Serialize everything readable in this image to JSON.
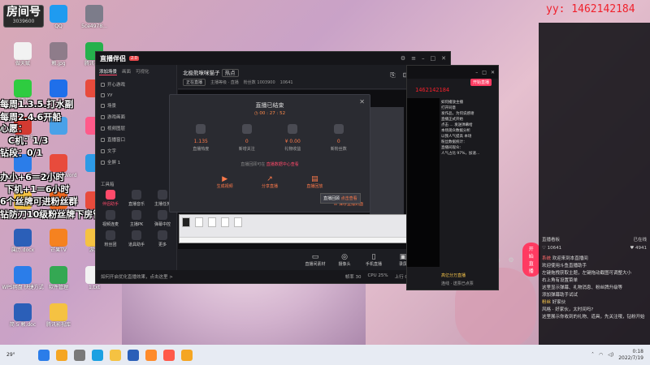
{
  "overlay": {
    "room_label": "房间号",
    "room_id": "3039600",
    "yy": "yy: 1462142184",
    "lines": [
      "每周1.3.5.打水副",
      "每周2.4.6开船",
      "心愿：",
      "C机：1/3",
      "钻段：0/1",
      "办小+6＝2小时",
      "下机+1＝6小时",
      "6个丝牌可进粉丝群",
      "钻防刀10级粉丝牌下房管"
    ]
  },
  "desktop_icons": [
    {
      "label": "",
      "color": "#e84b3c"
    },
    {
      "label": "QQ",
      "color": "#1f9bf0"
    },
    {
      "label": "5ce4978...",
      "color": "#7c7c8a"
    },
    {
      "label": "做天赋",
      "color": "#f2f2f2"
    },
    {
      "label": "赖.jpg",
      "color": "#8e7c8a"
    },
    {
      "label": "腾讯视频",
      "color": "#25b14c"
    },
    {
      "label": "爱奇艺",
      "color": "#2ecc40"
    },
    {
      "label": "",
      "color": "#1f6fea"
    },
    {
      "label": "",
      "color": "#e84b3c"
    },
    {
      "label": "网易云音乐",
      "color": "#d33a31"
    },
    {
      "label": "",
      "color": "#4aa1e8"
    },
    {
      "label": "",
      "color": "#ff5a8a"
    },
    {
      "label": "",
      "color": "#2b7de9"
    },
    {
      "label": "金山PDF转Word",
      "color": "#e84b3c"
    },
    {
      "label": "",
      "color": "#2d9ae6"
    },
    {
      "label": "搜狗高速浏览器",
      "color": "#f5c242"
    },
    {
      "label": "凡鱼直播伴侣",
      "color": "#f06a22"
    },
    {
      "label": "联想软件商店",
      "color": "#e84b3c"
    },
    {
      "label": "属历.docx",
      "color": "#2b5fb8"
    },
    {
      "label": "芒果TV",
      "color": "#f58220"
    },
    {
      "label": "游戏",
      "color": "#f5c242"
    },
    {
      "label": "WPS网盘 快捷方式",
      "color": "#2b7de9"
    },
    {
      "label": "软件管理",
      "color": "#34a853"
    },
    {
      "label": "1.txt",
      "color": "#f2f2f2"
    },
    {
      "label": "简 5 赖.doc",
      "color": "#2b5fb8"
    },
    {
      "label": "腾讯影视库",
      "color": "#f5c242"
    }
  ],
  "app": {
    "name": "直播伴侣",
    "version_badge": "2.0",
    "left_tabs": [
      "添加场景",
      "画面",
      "可视化"
    ],
    "scenes": [
      "开心游戏",
      "yy",
      "场景",
      "游戏画面",
      "视频图层",
      "直播窗口",
      "文字",
      "全屏 1"
    ],
    "tools_title": "工具箱",
    "tools": [
      {
        "label": "伴侣助手",
        "active": true
      },
      {
        "label": "直播音乐",
        "active": false
      },
      {
        "label": "主播任务",
        "active": false
      },
      {
        "label": "视频连麦",
        "active": false
      },
      {
        "label": "主播PK",
        "active": false
      },
      {
        "label": "弹幕中控",
        "active": false
      },
      {
        "label": "粉丝团",
        "active": false
      },
      {
        "label": "道具助手",
        "active": false
      },
      {
        "label": "更多",
        "active": false
      }
    ],
    "stream_title": "北极熊咪咪猫子",
    "stream_tag": "热点",
    "status_text": "正在直播",
    "meta": [
      "主播等级 · 直播",
      "粉丝数 1003900",
      "10641"
    ],
    "bottom_items": [
      {
        "label": "直播间素材",
        "icon": "▭"
      },
      {
        "label": "摄像头",
        "icon": "◎"
      },
      {
        "label": "手机直播",
        "icon": "▯"
      },
      {
        "label": "录屏",
        "icon": "▣"
      },
      {
        "label": "麦克风",
        "icon": "🎙"
      },
      {
        "label": "扬声器",
        "icon": "🔊"
      }
    ],
    "start_label": "开始直播",
    "notice": "如何开启优化直播效果，点击这里 >",
    "status_metrics": [
      "帧率 30",
      "CPU 25%",
      "上行 0.0kb/s",
      "丢帧 0%"
    ]
  },
  "popup": {
    "title": "直播已结束",
    "duration": "00 : 27 : 52",
    "stats": [
      {
        "value": "1.135",
        "label": "直播热度"
      },
      {
        "value": "0",
        "label": "新增关注"
      },
      {
        "value": "¥ 0.00",
        "label": "礼物收益"
      },
      {
        "value": "0",
        "label": "新粉丝数"
      }
    ],
    "hint_prefix": "直播回顾可在",
    "hint_link": "直播数据中心查看",
    "actions": [
      {
        "label": "生成视频",
        "icon": "▶"
      },
      {
        "label": "分享直播",
        "icon": "↗"
      },
      {
        "label": "直播回放",
        "icon": "▤"
      }
    ],
    "save_label": "保存直播封面",
    "tooltip_prefix": "直播回顾",
    "tooltip_link": "点击查看"
  },
  "side_window": {
    "number": "1462142184",
    "button": "开始直播",
    "chat": [
      "如何播放主播",
      "打开同意",
      "发作品，为何说感谢",
      "直播正式开始",
      "点击 ... 发送弹幕给",
      "本场观众数据分析",
      "以我人气提高 本场",
      "粉丝数据统计：",
      "直播间观众：",
      "人气占比 97%，加速..."
    ],
    "footer": "高亿分万直播",
    "footer2": "连线 · 送票已点票"
  },
  "right_panel": {
    "title": "直播看板",
    "online": "已在线",
    "stats": [
      "♡ 10641",
      "♥ 4941"
    ],
    "messages": [
      {
        "name": "系统",
        "text": "欢迎来到本直播间",
        "sys": true
      },
      {
        "name": "",
        "text": "欢迎使用斗鱼直播助手",
        "sys": false
      },
      {
        "name": "",
        "text": "左键拖拽获取主题，左键拖动截图可调整大小",
        "sys": false
      },
      {
        "name": "",
        "text": "右上角有设置菜单",
        "sys": false
      },
      {
        "name": "",
        "text": "这里显示弹幕、礼物消息、粉丝牌升级等",
        "sys": false
      },
      {
        "name": "",
        "text": "添加弹幕助手试试",
        "sys": false
      },
      {
        "name": "粉丝",
        "text": "好家伙",
        "sys": false
      },
      {
        "name": "",
        "text": "风格 · 好家伙，太时间吗?",
        "sys": false
      },
      {
        "name": "",
        "text": "这里展示你收到的礼物、道具，先关注哦，钻粉开始",
        "sys": false
      }
    ]
  },
  "taskbar": {
    "weather": "29°",
    "time": "0:18",
    "date": "2022/7/19",
    "icons": [
      {
        "name": "start",
        "color": "#2b7de9"
      },
      {
        "name": "widgets",
        "color": "#f5a623"
      },
      {
        "name": "search",
        "color": "#7a7a7a"
      },
      {
        "name": "edge",
        "color": "#1ba1e2"
      },
      {
        "name": "explorer",
        "color": "#f5c242"
      },
      {
        "name": "store",
        "color": "#2b5fb8"
      },
      {
        "name": "app1",
        "color": "#ff8b2b"
      },
      {
        "name": "app2",
        "color": "#ff5a4a"
      },
      {
        "name": "app3",
        "color": "#f5a623"
      }
    ]
  }
}
